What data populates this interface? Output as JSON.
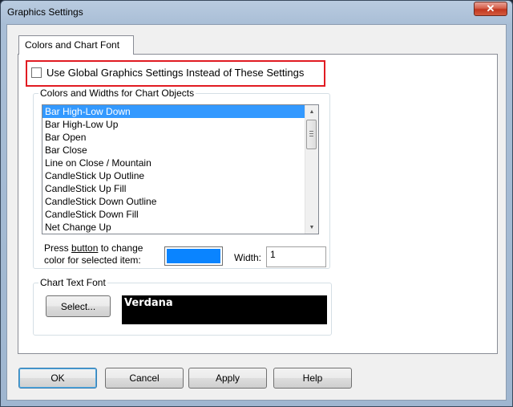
{
  "window": {
    "title": "Graphics Settings",
    "close_glyph": "✕"
  },
  "tabs": [
    {
      "label": "Colors and Chart Font",
      "selected": true
    }
  ],
  "global_settings": {
    "label": "Use Global Graphics Settings Instead of These Settings",
    "checked": false
  },
  "colors_group": {
    "legend": "Colors and Widths for Chart Objects",
    "items": [
      "Bar High-Low Down",
      "Bar High-Low Up",
      "Bar Open",
      "Bar Close",
      "Line on Close / Mountain",
      "CandleStick Up Outline",
      "CandleStick Up Fill",
      "CandleStick Down Outline",
      "CandleStick Down Fill",
      "Net Change Up"
    ],
    "selected_index": 0,
    "press_label_pre": "Press ",
    "press_label_mnemonic": "button",
    "press_label_post": " to change",
    "press_label_line2": "color for selected item:",
    "selected_color": "#0a84ff",
    "width_label": "Width:",
    "width_value": "1"
  },
  "font_group": {
    "legend": "Chart Text Font",
    "select_button": "Select...",
    "font_name": "Verdana"
  },
  "buttons": {
    "ok": "OK",
    "cancel": "Cancel",
    "apply": "Apply",
    "help": "Help"
  },
  "colors": {
    "highlight_border": "#e11b22",
    "selection": "#3399ff",
    "font_preview_bg": "#000000"
  },
  "icons": {
    "close": "close-icon",
    "scroll_up": "scroll-up-icon",
    "scroll_down": "scroll-down-icon"
  }
}
